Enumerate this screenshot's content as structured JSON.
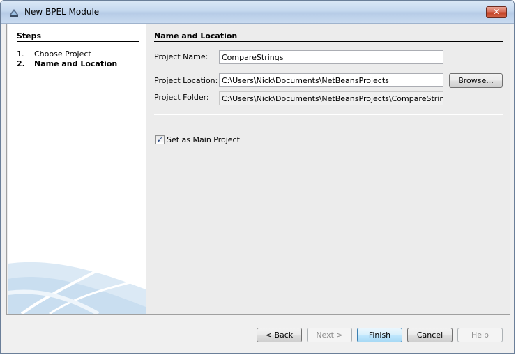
{
  "window": {
    "title": "New BPEL Module",
    "close_glyph": "✕"
  },
  "steps": {
    "title": "Steps",
    "items": [
      {
        "num": "1.",
        "label": "Choose Project"
      },
      {
        "num": "2.",
        "label": "Name and Location"
      }
    ]
  },
  "form": {
    "section_title": "Name and Location",
    "project_name_label": "Project Name:",
    "project_name_value": "CompareStrings",
    "project_location_label": "Project Location:",
    "project_location_value": "C:\\Users\\Nick\\Documents\\NetBeansProjects",
    "browse_label": "Browse...",
    "project_folder_label": "Project Folder:",
    "project_folder_value": "C:\\Users\\Nick\\Documents\\NetBeansProjects\\CompareStrings",
    "main_project_label": "Set as Main Project",
    "main_project_checked": true,
    "check_glyph": "✓"
  },
  "buttons": {
    "back": "< Back",
    "next": "Next >",
    "finish": "Finish",
    "cancel": "Cancel",
    "help": "Help"
  },
  "icons": {
    "app_icon": "netbeans-icon",
    "close_icon": "close-icon",
    "check_icon": "checkmark-icon"
  }
}
